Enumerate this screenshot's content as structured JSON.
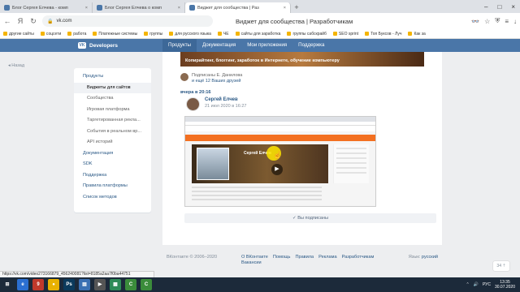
{
  "browser": {
    "tabs": [
      {
        "title": "Блог Сергея Елчева - комп",
        "active": false
      },
      {
        "title": "Блог Сергея Елчева о комп",
        "active": false
      },
      {
        "title": "Виджет для сообщества | Раз",
        "active": true
      }
    ],
    "new_tab": "+",
    "url": "vk.com",
    "page_title": "Виджет для сообщества | Разработчикам",
    "bookmarks": [
      "другие сайты",
      "соцсети",
      "работа",
      "Платежные системы",
      "группы",
      "для русского языка",
      "ЧЕ",
      "сайты для заработка",
      "группы сабскрайб",
      "SEO sprint",
      "Топ Буксов - Луч",
      "Как за"
    ]
  },
  "vk": {
    "logo": "Developers",
    "nav": [
      "Продукты",
      "Документация",
      "Мои приложения",
      "Поддержка"
    ],
    "active_nav": "Продукты",
    "back_link": "Назад"
  },
  "left_menu": {
    "items": [
      {
        "label": "Продукты",
        "sub": false,
        "active": false
      },
      {
        "label": "Виджеты для сайтов",
        "sub": true,
        "active": true
      },
      {
        "label": "Сообщества",
        "sub": true,
        "active": false
      },
      {
        "label": "Игровая платформа",
        "sub": true,
        "active": false
      },
      {
        "label": "Таргетированная рекла...",
        "sub": true,
        "active": false
      },
      {
        "label": "События в реальном вр...",
        "sub": true,
        "active": false
      },
      {
        "label": "API историй",
        "sub": true,
        "active": false
      },
      {
        "label": "Документация",
        "sub": false,
        "active": false
      },
      {
        "label": "SDK",
        "sub": false,
        "active": false
      },
      {
        "label": "Поддержка",
        "sub": false,
        "active": false
      },
      {
        "label": "Правила платформы",
        "sub": false,
        "active": false
      },
      {
        "label": "Список методов",
        "sub": false,
        "active": false
      }
    ]
  },
  "post": {
    "banner_text": "Копирайтинг, блоггинг, заработок в Интернете, обучение компьютеру",
    "subscribed_prefix": "Подписаны Е. Данилова",
    "subscribed_friends": "и ещё 12 Ваших друзей",
    "when": "вчера в 20:16",
    "author": "Сергей Елчев",
    "date": "21 июл 2020 в 16:27",
    "inner_name": "Сергей Елчев",
    "subscribed_button": "✓ Вы подписаны"
  },
  "footer": {
    "copyright": "ВКонтакте © 2006–2020",
    "links": [
      "О ВКонтакте",
      "Помощь",
      "Правила",
      "Реклама",
      "Разработчикам",
      "Вакансии"
    ],
    "language_label": "Язык:",
    "language": "русский"
  },
  "scroll_indicator": "34 ⇡",
  "status_url": "https://vk.com/video273166879_456240081?list=8185a2aa7f0ba44751",
  "taskbar": {
    "apps": [
      {
        "label": "⊞",
        "color": "#1c2a3a"
      },
      {
        "label": "e",
        "color": "#2b6fd1"
      },
      {
        "label": "9",
        "color": "#c0392b"
      },
      {
        "label": "●",
        "color": "#e8b100"
      },
      {
        "label": "Ps",
        "color": "#0b3a5c"
      },
      {
        "label": "▤",
        "color": "#3a70b3"
      },
      {
        "label": "▶",
        "color": "#555"
      },
      {
        "label": "▦",
        "color": "#2e8b57"
      },
      {
        "label": "C",
        "color": "#3b8c3b"
      },
      {
        "label": "C",
        "color": "#3b8c3b"
      }
    ],
    "lang": "РУС",
    "time": "13:35",
    "date": "30.07.2020"
  }
}
